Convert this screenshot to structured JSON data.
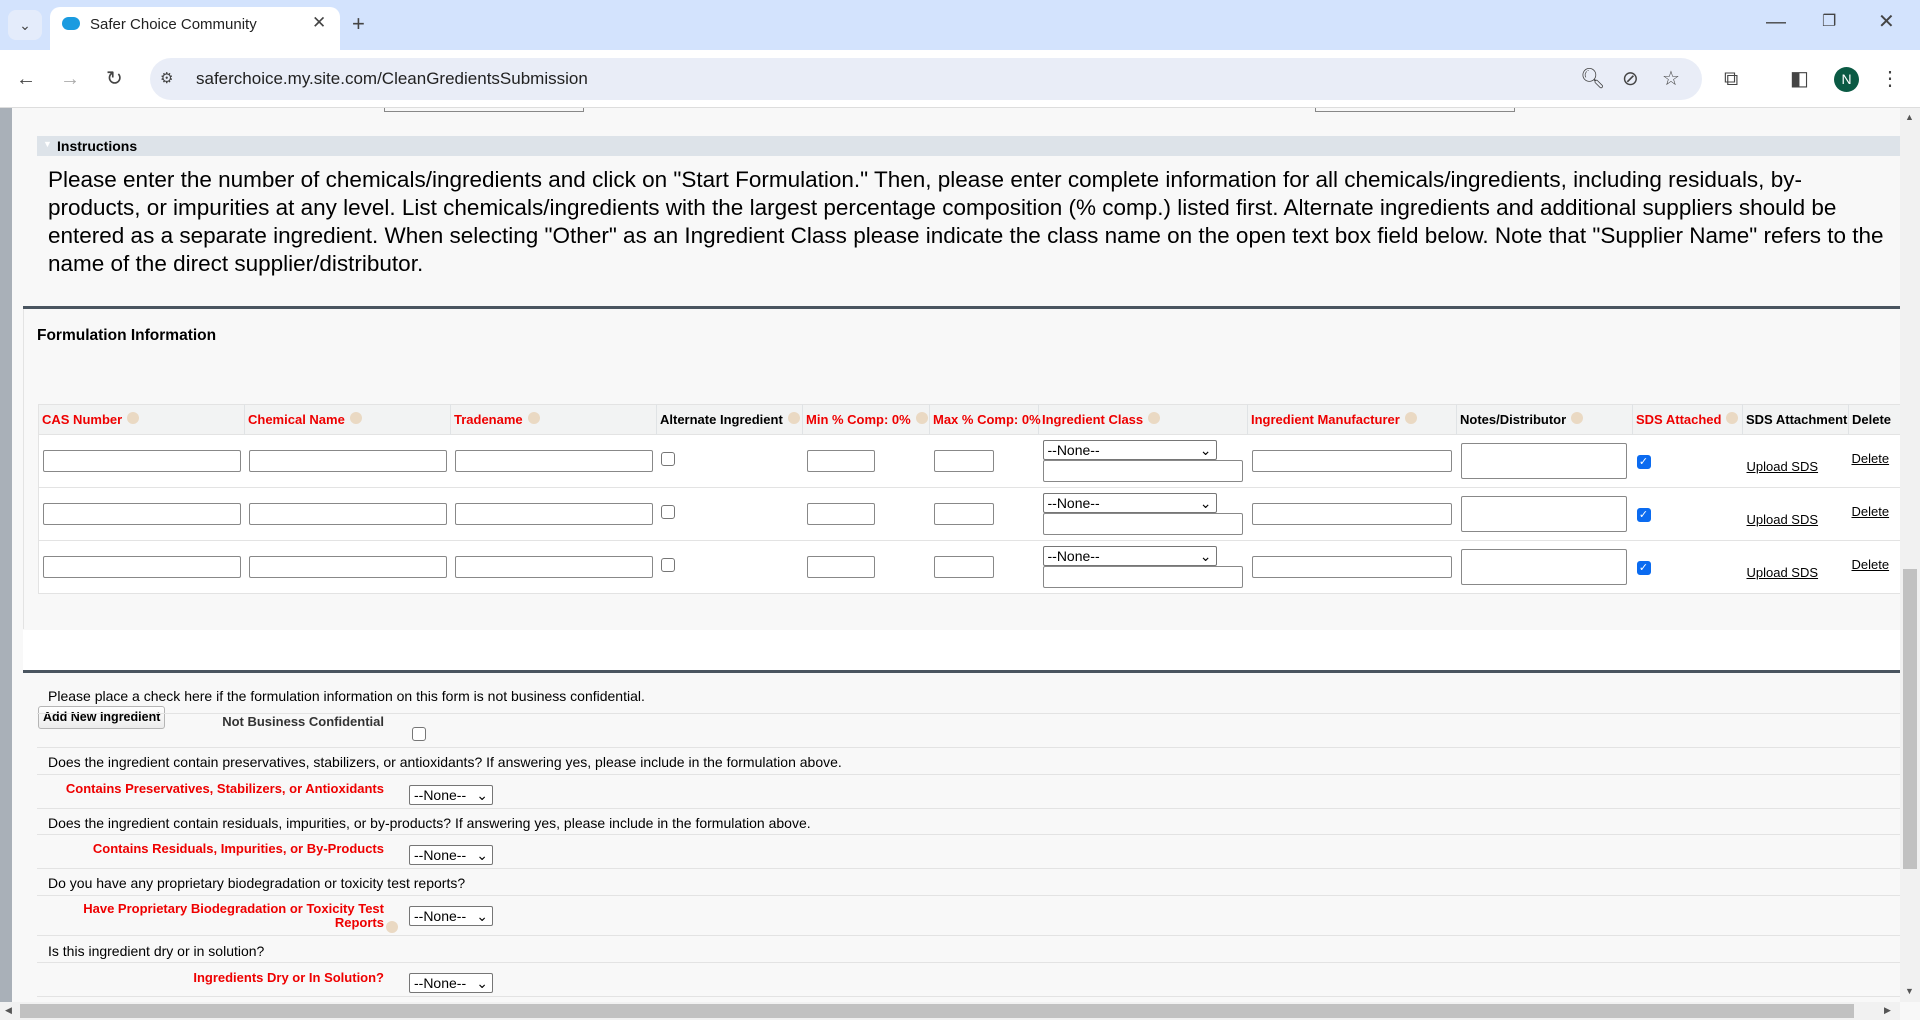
{
  "browser": {
    "tab_title": "Safer Choice Community",
    "url": "saferchoice.my.site.com/CleanGredientsSubmission",
    "profile_initial": "N",
    "accent": "#d3e3fd"
  },
  "instructions": {
    "header": "Instructions",
    "text": "Please enter the number of chemicals/ingredients and click on \"Start Formulation.\" Then, please enter complete information for all chemicals/ingredients, including residuals, by-products, or impurities at any level. List chemicals/ingredients with the largest percentage composition (% comp.) listed first. Alternate ingredients and additional suppliers should be entered as a separate ingredient. When selecting \"Other\" as an Ingredient Class please indicate the class name on the open text box field below. Note that \"Supplier Name\" refers to the name of the direct supplier/distributor."
  },
  "formulation": {
    "title": "Formulation Information",
    "columns": [
      "CAS Number",
      "Chemical Name",
      "Tradename",
      "Alternate Ingredient",
      "Min % Comp: 0%",
      "Max % Comp: 0%",
      "Ingredient Class",
      "Ingredient Manufacturer",
      "Notes/Distributor",
      "SDS Attached",
      "SDS Attachment",
      "Delete"
    ],
    "rows": [
      {
        "ingredient_class": "--None--",
        "sds_attached": true,
        "upload": "Upload SDS",
        "delete": "Delete"
      },
      {
        "ingredient_class": "--None--",
        "sds_attached": true,
        "upload": "Upload SDS",
        "delete": "Delete"
      },
      {
        "ingredient_class": "--None--",
        "sds_attached": true,
        "upload": "Upload SDS",
        "delete": "Delete"
      }
    ],
    "add_button": "Add New Ingredient"
  },
  "questions": {
    "q1": "Please place a check here if the formulation information on this form is not business confidential.",
    "l1": "Not Business Confidential",
    "q2": "Does the ingredient contain preservatives, stabilizers, or antioxidants? If answering yes, please include in the formulation above.",
    "l2": "Contains Preservatives, Stabilizers, or Antioxidants",
    "q3": "Does the ingredient contain residuals, impurities, or by-products? If answering yes, please include in the formulation above.",
    "l3": "Contains Residuals, Impurities, or By-Products",
    "q4": "Do you have any proprietary biodegradation or toxicity test reports?",
    "l4": "Have Proprietary Biodegradation or Toxicity Test Reports",
    "q5": "Is this ingredient dry or in solution?",
    "l5": "Ingredients Dry or In Solution?",
    "none": "--None--"
  }
}
